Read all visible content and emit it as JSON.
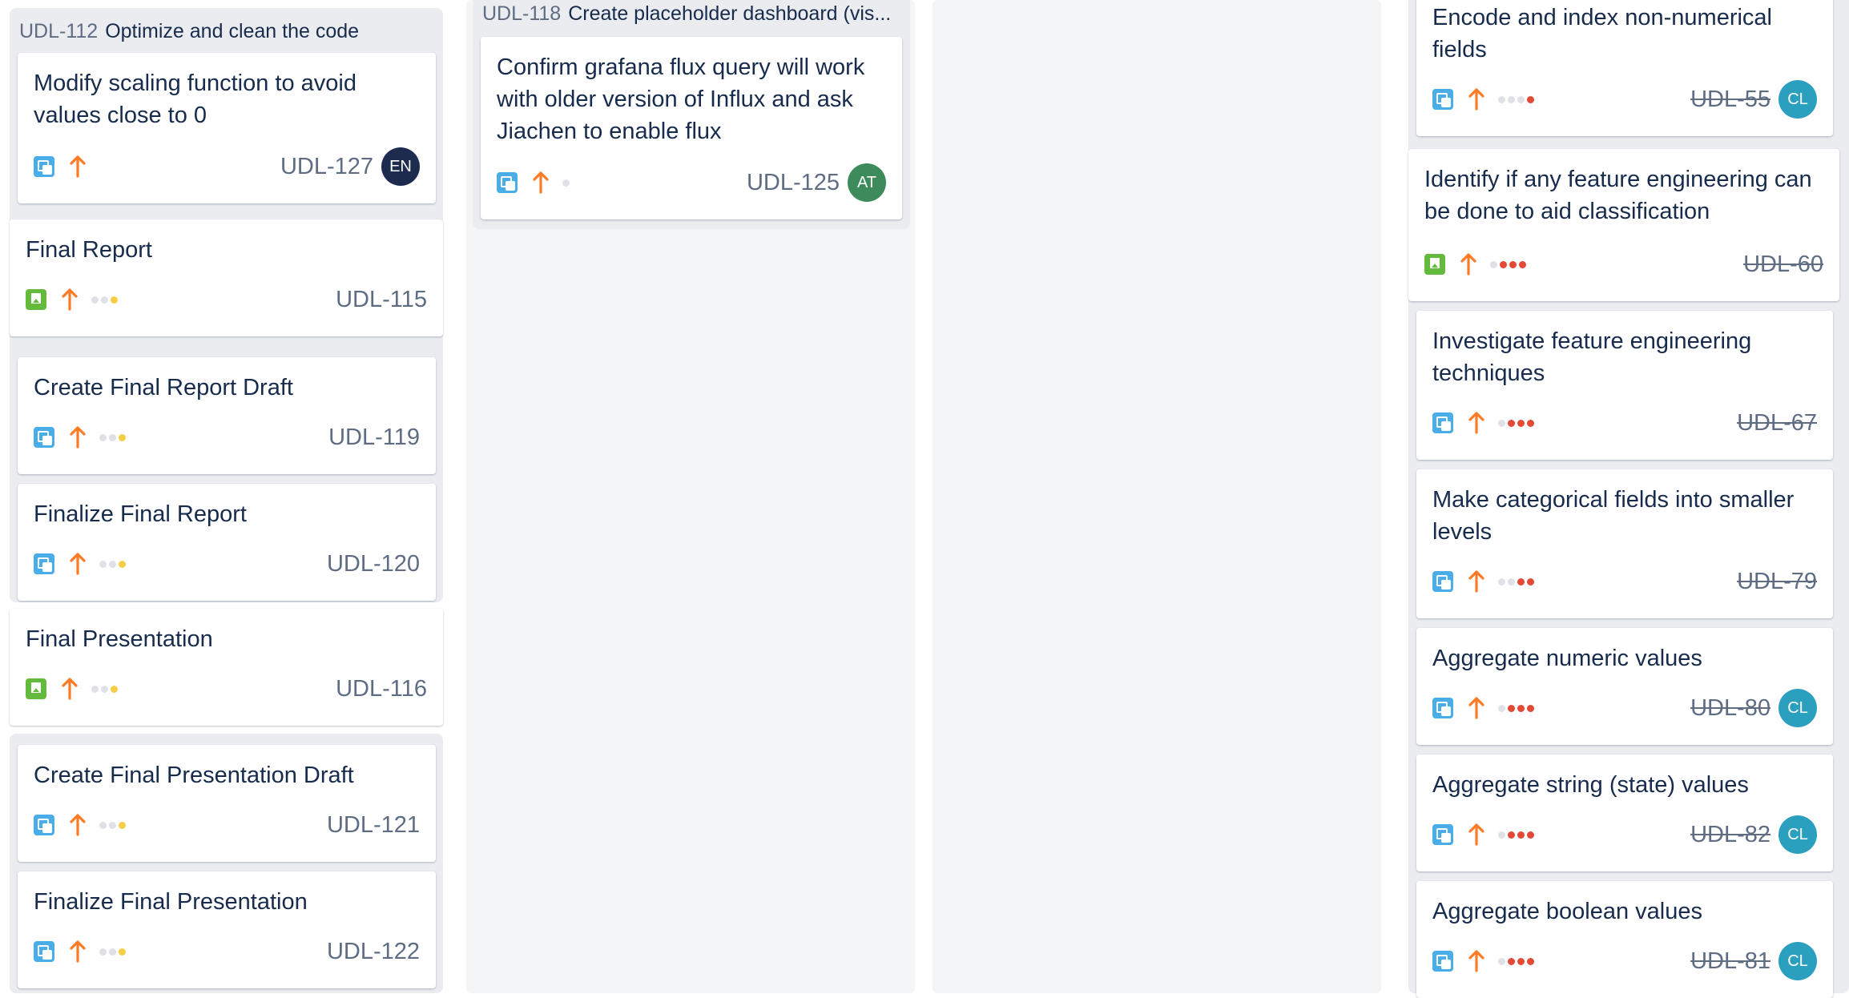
{
  "colors": {
    "dot_gray": "#dfe1e6",
    "dot_yellow": "#f5cd47",
    "dot_red": "#e34935",
    "priority_orange": "#ff7a25",
    "avatar_en": "#1d2b4f",
    "avatar_at": "#3d8b5a",
    "avatar_cl": "#2a9fbe"
  },
  "groups": {
    "g112": {
      "key": "UDL-112",
      "title": "Optimize and clean the code"
    },
    "g118": {
      "key": "UDL-118",
      "title": "Create placeholder dashboard (vis..."
    }
  },
  "cards": {
    "c127": {
      "title": "Modify scaling function to avoid values close to 0",
      "key": "UDL-127",
      "type": "task-icon",
      "avatar": "EN"
    },
    "c115": {
      "title": "Final Report",
      "key": "UDL-115",
      "type": "story-icon"
    },
    "c119": {
      "title": "Create Final Report Draft",
      "key": "UDL-119",
      "type": "task-icon"
    },
    "c120": {
      "title": "Finalize Final Report",
      "key": "UDL-120",
      "type": "task-icon"
    },
    "c116": {
      "title": "Final Presentation",
      "key": "UDL-116",
      "type": "story-icon"
    },
    "c121": {
      "title": "Create Final Presentation Draft",
      "key": "UDL-121",
      "type": "task-icon"
    },
    "c122": {
      "title": "Finalize Final Presentation",
      "key": "UDL-122",
      "type": "task-icon"
    },
    "c125": {
      "title": "Confirm grafana flux query will work with older version of Influx and ask Jiachen to enable flux",
      "key": "UDL-125",
      "type": "task-icon",
      "avatar": "AT"
    },
    "c55": {
      "title": "Encode and index non-numerical fields",
      "key": "UDL-55",
      "type": "task-icon",
      "avatar": "CL"
    },
    "c60": {
      "title": "Identify if any feature engineering can be done to aid classification",
      "key": "UDL-60",
      "type": "story-icon"
    },
    "c67": {
      "title": "Investigate feature engineering techniques",
      "key": "UDL-67",
      "type": "task-icon"
    },
    "c79": {
      "title": "Make categorical fields into smaller levels",
      "key": "UDL-79",
      "type": "task-icon"
    },
    "c80": {
      "title": "Aggregate numeric values",
      "key": "UDL-80",
      "type": "task-icon",
      "avatar": "CL"
    },
    "c82": {
      "title": "Aggregate string (state) values",
      "key": "UDL-82",
      "type": "task-icon",
      "avatar": "CL"
    },
    "c81": {
      "title": "Aggregate boolean values",
      "key": "UDL-81",
      "type": "task-icon",
      "avatar": "CL"
    }
  }
}
